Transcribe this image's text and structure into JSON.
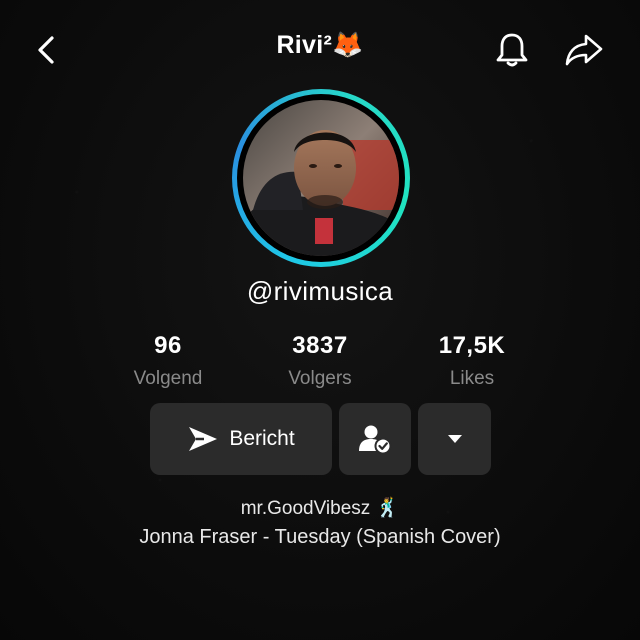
{
  "header": {
    "title": "Rivi²",
    "title_emoji": "🦊",
    "icons": [
      "back-icon",
      "bell-icon",
      "share-icon"
    ]
  },
  "profile": {
    "handle": "@rivimusica"
  },
  "stats": [
    {
      "value": "96",
      "label": "Volgend"
    },
    {
      "value": "3837",
      "label": "Volgers"
    },
    {
      "value": "17,5K",
      "label": "Likes"
    }
  ],
  "actions": {
    "message_label": "Bericht",
    "follow_icon": "user-check-icon",
    "more_icon": "caret-down-icon"
  },
  "bio": {
    "line1": "mr.GoodVibesz",
    "line1_emoji": "🕺",
    "line2": "Jonna Fraser - Tuesday (Spanish Cover)"
  },
  "colors": {
    "background": "#0c0c0c",
    "button": "#2b2b2b",
    "ring_start": "#2a8fe0",
    "ring_end": "#20e3c0",
    "muted_text": "#8a8a8a"
  }
}
